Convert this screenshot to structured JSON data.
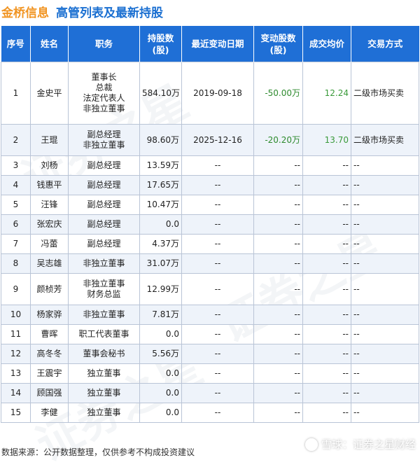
{
  "header": {
    "company": "金桥信息",
    "subtitle": "高管列表及最新持股"
  },
  "table": {
    "columns": [
      "序号",
      "姓名",
      "职务",
      "持股数\n(股)",
      "最近变动日期",
      "变动股数\n(股)",
      "成交均价",
      "交易方式"
    ],
    "rows": [
      {
        "no": "1",
        "name": "金史平",
        "duties": [
          "董事长",
          "总裁",
          "法定代表人",
          "非独立董事"
        ],
        "shares": "584.10万",
        "date": "2019-09-18",
        "change": "-50.00万",
        "price": "12.24",
        "method": "二级市场买卖"
      },
      {
        "no": "2",
        "name": "王琨",
        "duties": [
          "副总经理",
          "非独立董事"
        ],
        "shares": "98.60万",
        "date": "2025-12-16",
        "change": "-20.20万",
        "price": "13.70",
        "method": "二级市场买卖"
      },
      {
        "no": "3",
        "name": "刘杨",
        "duties": [
          "副总经理"
        ],
        "shares": "13.59万",
        "date": "--",
        "change": "--",
        "price": "--",
        "method": "--"
      },
      {
        "no": "4",
        "name": "钱惠平",
        "duties": [
          "副总经理"
        ],
        "shares": "17.65万",
        "date": "--",
        "change": "--",
        "price": "--",
        "method": "--"
      },
      {
        "no": "5",
        "name": "汪锋",
        "duties": [
          "副总经理"
        ],
        "shares": "10.47万",
        "date": "--",
        "change": "--",
        "price": "--",
        "method": "--"
      },
      {
        "no": "6",
        "name": "张宏庆",
        "duties": [
          "副总经理"
        ],
        "shares": "0.0",
        "date": "--",
        "change": "--",
        "price": "--",
        "method": "--"
      },
      {
        "no": "7",
        "name": "冯蕾",
        "duties": [
          "副总经理"
        ],
        "shares": "4.37万",
        "date": "--",
        "change": "--",
        "price": "--",
        "method": "--"
      },
      {
        "no": "8",
        "name": "吴志雄",
        "duties": [
          "非独立董事"
        ],
        "shares": "31.07万",
        "date": "--",
        "change": "--",
        "price": "--",
        "method": "--"
      },
      {
        "no": "9",
        "name": "颜桢芳",
        "duties": [
          "非独立董事",
          "财务总监"
        ],
        "shares": "12.99万",
        "date": "--",
        "change": "--",
        "price": "--",
        "method": "--"
      },
      {
        "no": "10",
        "name": "杨家骅",
        "duties": [
          "非独立董事"
        ],
        "shares": "7.81万",
        "date": "--",
        "change": "--",
        "price": "--",
        "method": "--"
      },
      {
        "no": "11",
        "name": "曹晖",
        "duties": [
          "职工代表董事"
        ],
        "shares": "0.0",
        "date": "--",
        "change": "--",
        "price": "--",
        "method": "--"
      },
      {
        "no": "12",
        "name": "高冬冬",
        "duties": [
          "董事会秘书"
        ],
        "shares": "5.56万",
        "date": "--",
        "change": "--",
        "price": "--",
        "method": "--"
      },
      {
        "no": "13",
        "name": "王震宇",
        "duties": [
          "独立董事"
        ],
        "shares": "0.0",
        "date": "--",
        "change": "--",
        "price": "--",
        "method": "--"
      },
      {
        "no": "14",
        "name": "顾国强",
        "duties": [
          "独立董事"
        ],
        "shares": "0.0",
        "date": "--",
        "change": "--",
        "price": "--",
        "method": "--"
      },
      {
        "no": "15",
        "name": "李健",
        "duties": [
          "独立董事"
        ],
        "shares": "0.0",
        "date": "--",
        "change": "--",
        "price": "--",
        "method": "--"
      }
    ]
  },
  "footer": {
    "source": "数据来源：公开数据整理，仅供参考不构成投资建议",
    "brand": "雪球：证券之星财经"
  },
  "watermark_text": "证券之星",
  "colors": {
    "header_bg": "#1f6fd6",
    "company": "#f19422",
    "subtitle": "#1a6fd1",
    "price_green": "#3a9a3a",
    "stripe": "#eef3fa"
  }
}
